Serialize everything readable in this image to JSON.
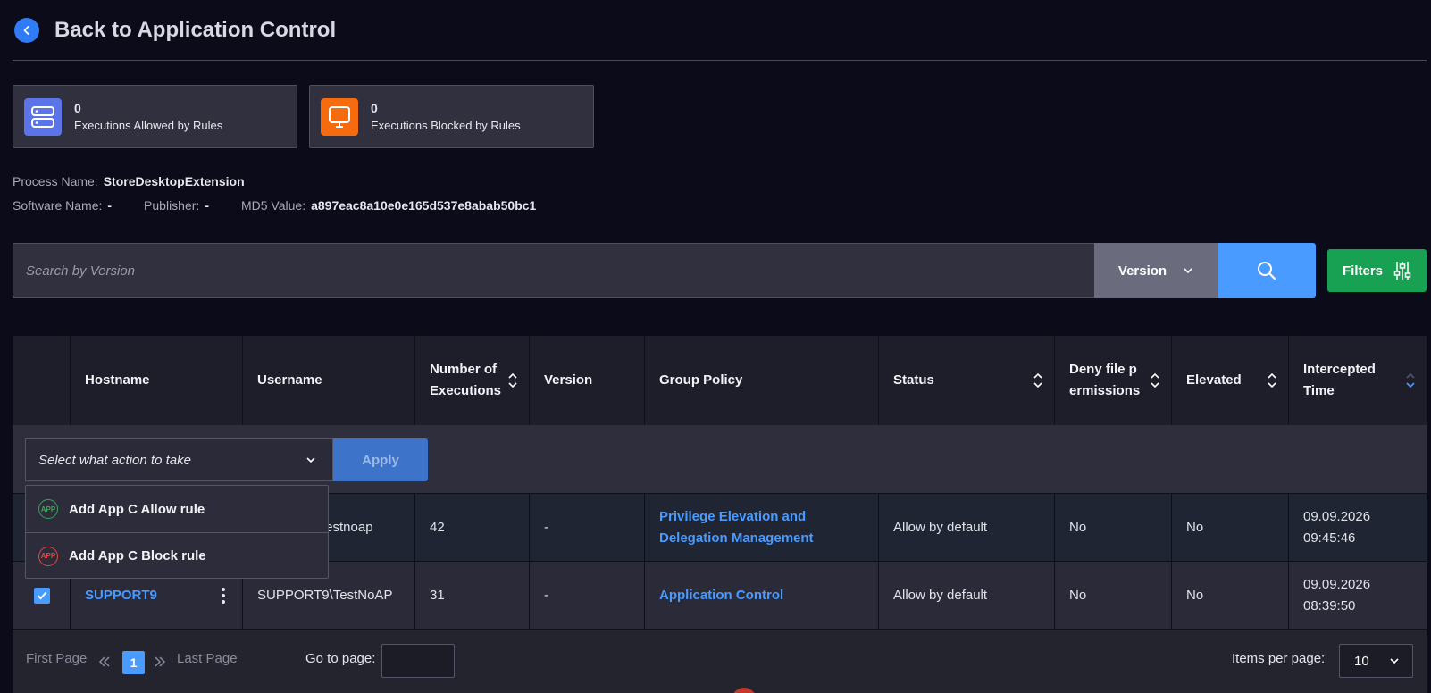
{
  "header": {
    "title": "Back to Application Control"
  },
  "cards": [
    {
      "count": "0",
      "label": "Executions Allowed by Rules",
      "icon": "server-icon",
      "color": "#5b74e8"
    },
    {
      "count": "0",
      "label": "Executions Blocked by Rules",
      "icon": "monitor-icon",
      "color": "#f56b0f"
    }
  ],
  "info": {
    "process_label": "Process Name:",
    "process_value": "StoreDesktopExtension",
    "software_label": "Software Name:",
    "software_value": "-",
    "publisher_label": "Publisher:",
    "publisher_value": "-",
    "md5_label": "MD5 Value:",
    "md5_value": "a897eac8a10e0e165d537e8abab50bc1"
  },
  "search": {
    "placeholder": "Search by Version",
    "field": "Version",
    "filters_label": "Filters"
  },
  "table": {
    "columns": [
      "",
      "Hostname",
      "Username",
      "Number of Executions",
      "Version",
      "Group Policy",
      "Status",
      "Deny file permissions",
      "Elevated",
      "Intercepted Time"
    ],
    "action_placeholder": "Select what action to take",
    "apply_label": "Apply",
    "rows": [
      {
        "hostname": "",
        "username": "testnoap",
        "executions": "42",
        "version": "-",
        "group_policy": "Privilege Elevation and Delegation Management",
        "status": "Allow by default",
        "deny": "No",
        "elevated": "No",
        "time": "09.09.2026 09:45:46"
      },
      {
        "hostname": "SUPPORT9",
        "username": "SUPPORT9\\TestNoAP",
        "executions": "31",
        "version": "-",
        "group_policy": "Application Control",
        "status": "Allow by default",
        "deny": "No",
        "elevated": "No",
        "time": "09.09.2026 08:39:50"
      }
    ]
  },
  "dropdown": {
    "items": [
      {
        "label": "Add App C Allow rule",
        "icon_text": "APP",
        "color": "#3aa55b"
      },
      {
        "label": "Add App C Block rule",
        "icon_text": "APP",
        "color": "#e04848"
      }
    ]
  },
  "pager": {
    "first": "First Page",
    "current": "1",
    "last": "Last Page",
    "goto_label": "Go to page:",
    "per_page_label": "Items per page:",
    "per_page_value": "10"
  }
}
